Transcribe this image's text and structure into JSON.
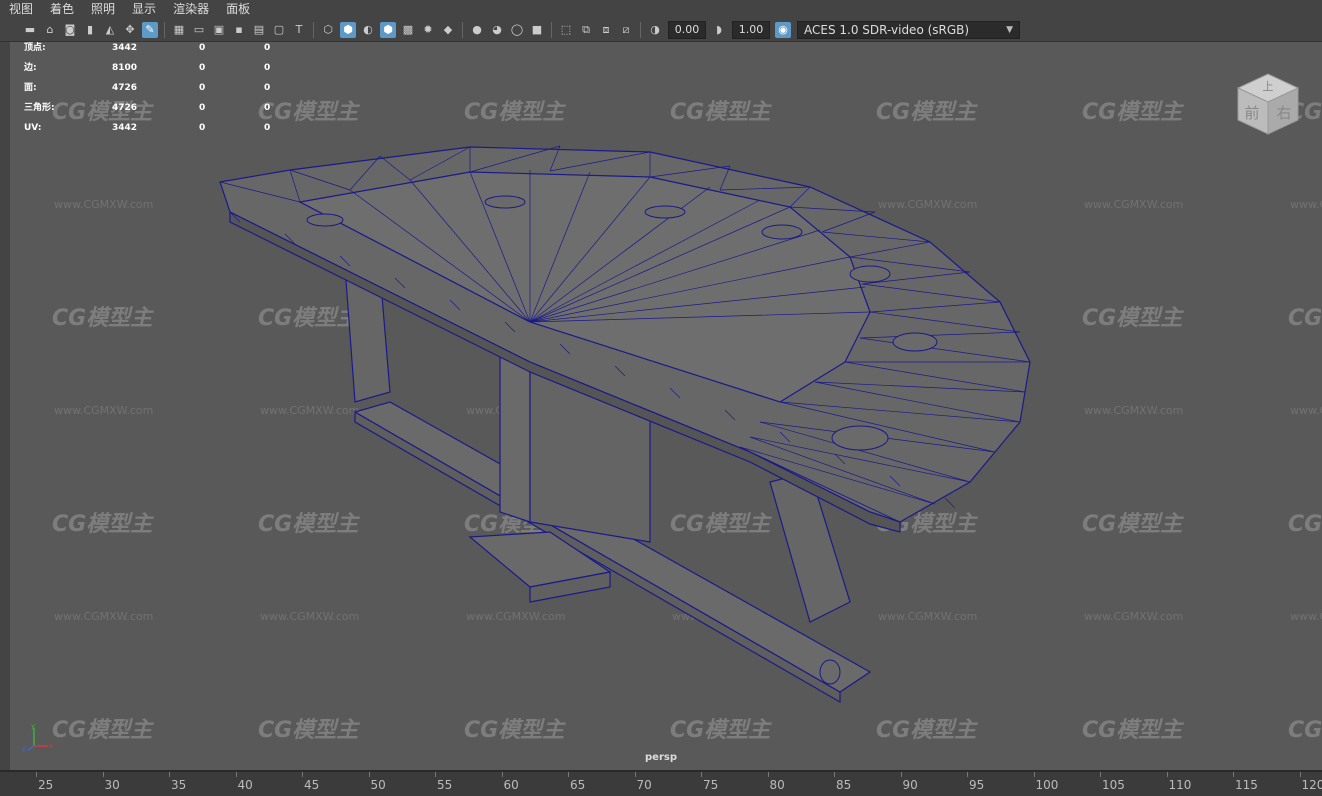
{
  "menu": [
    "视图",
    "着色",
    "照明",
    "显示",
    "渲染器",
    "面板"
  ],
  "toolbar": {
    "exposure": "0.00",
    "gamma": "1.00",
    "color_space": "ACES 1.0 SDR-video (sRGB)"
  },
  "hud": {
    "rows": [
      {
        "label": "顶点:",
        "v1": "3442",
        "v2": "0",
        "v3": "0"
      },
      {
        "label": "边:",
        "v1": "8100",
        "v2": "0",
        "v3": "0"
      },
      {
        "label": "面:",
        "v1": "4726",
        "v2": "0",
        "v3": "0"
      },
      {
        "label": "三角形:",
        "v1": "4726",
        "v2": "0",
        "v3": "0"
      },
      {
        "label": "UV:",
        "v1": "3442",
        "v2": "0",
        "v3": "0"
      }
    ]
  },
  "watermark": {
    "brand": "CG模型主",
    "url": "www.CGMXW.com"
  },
  "viewcube": {
    "top": "上",
    "front": "前",
    "right": "右"
  },
  "camera_label": "persp",
  "timeline": {
    "ticks": [
      "25",
      "30",
      "35",
      "40",
      "45",
      "50",
      "55",
      "60",
      "65",
      "70",
      "75",
      "80",
      "85",
      "90",
      "95",
      "100",
      "105",
      "110",
      "115",
      "120"
    ]
  },
  "colors": {
    "wire": "#1a1a8a",
    "viewport_bg": "#595959",
    "accent": "#5d9ac7"
  }
}
